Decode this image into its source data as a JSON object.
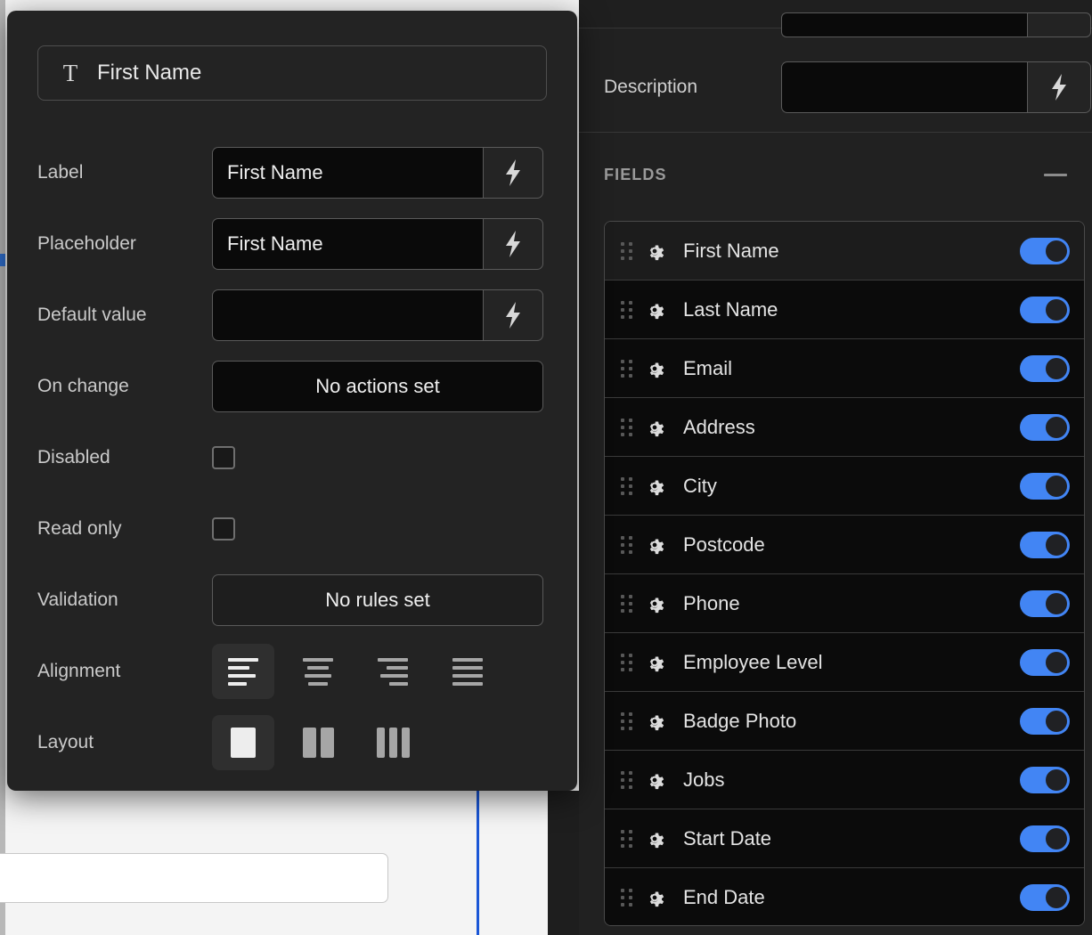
{
  "modal": {
    "header": {
      "type_icon": "text-type-icon",
      "title": "First Name"
    },
    "rows": [
      {
        "label": "Label",
        "kind": "combo",
        "value": "First Name",
        "bolt": "lightning-bolt-icon"
      },
      {
        "label": "Placeholder",
        "kind": "combo",
        "value": "First Name",
        "bolt": "lightning-bolt-icon"
      },
      {
        "label": "Default value",
        "kind": "combo",
        "value": "",
        "bolt": "lightning-bolt-icon"
      },
      {
        "label": "On change",
        "kind": "button",
        "value": "No actions set"
      },
      {
        "label": "Disabled",
        "kind": "checkbox",
        "checked": false
      },
      {
        "label": "Read only",
        "kind": "checkbox",
        "checked": false
      },
      {
        "label": "Validation",
        "kind": "button",
        "value": "No rules set"
      },
      {
        "label": "Alignment",
        "kind": "icongroup"
      },
      {
        "label": "Layout",
        "kind": "icongroup"
      }
    ],
    "alignment_options": [
      {
        "name": "align-left-icon",
        "selected": true
      },
      {
        "name": "align-center-icon",
        "selected": false
      },
      {
        "name": "align-right-icon",
        "selected": false
      },
      {
        "name": "align-justify-icon",
        "selected": false
      }
    ],
    "layout_options": [
      {
        "name": "layout-one-column-icon",
        "selected": true
      },
      {
        "name": "layout-two-column-icon",
        "selected": false
      },
      {
        "name": "layout-three-column-icon",
        "selected": false
      }
    ]
  },
  "right_panel": {
    "description_row": {
      "label": "Description",
      "value": "",
      "bolt": "lightning-bolt-icon"
    },
    "fields_section": {
      "title": "FIELDS",
      "collapse_icon": "minus-icon",
      "items": [
        {
          "name": "First Name",
          "enabled": true,
          "active": true
        },
        {
          "name": "Last Name",
          "enabled": true,
          "active": false
        },
        {
          "name": "Email",
          "enabled": true,
          "active": false
        },
        {
          "name": "Address",
          "enabled": true,
          "active": false
        },
        {
          "name": "City",
          "enabled": true,
          "active": false
        },
        {
          "name": "Postcode",
          "enabled": true,
          "active": false
        },
        {
          "name": "Phone",
          "enabled": true,
          "active": false
        },
        {
          "name": "Employee Level",
          "enabled": true,
          "active": false
        },
        {
          "name": "Badge Photo",
          "enabled": true,
          "active": false
        },
        {
          "name": "Jobs",
          "enabled": true,
          "active": false
        },
        {
          "name": "Start Date",
          "enabled": true,
          "active": false
        },
        {
          "name": "End Date",
          "enabled": true,
          "active": false
        }
      ]
    }
  },
  "colors": {
    "accent_blue": "#4285f4",
    "resize_line": "#1a56d6",
    "modal_bg": "#232323",
    "panel_bg": "#212121",
    "list_bg": "#0b0b0b"
  }
}
